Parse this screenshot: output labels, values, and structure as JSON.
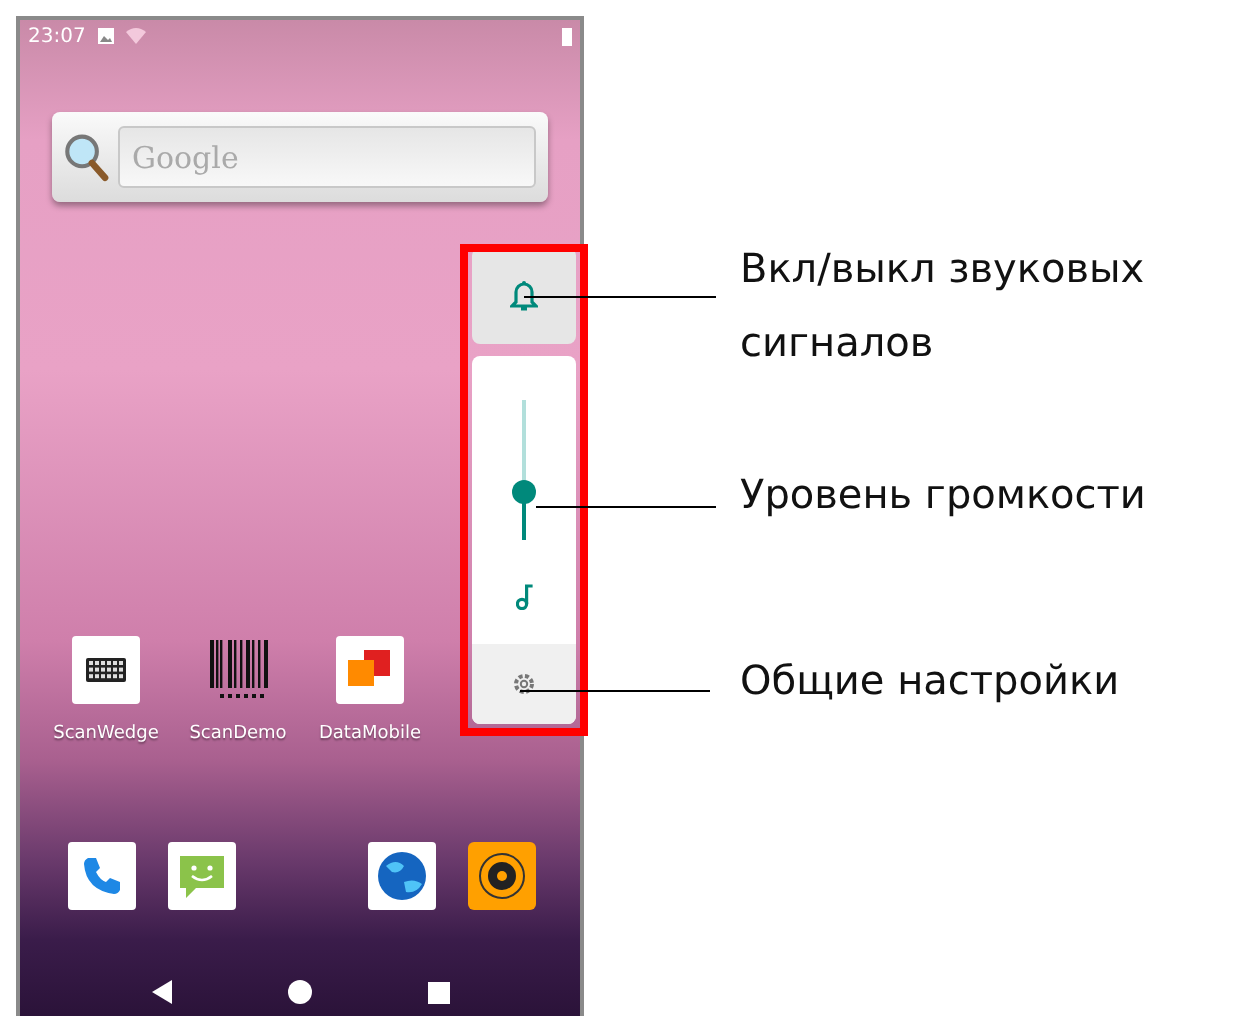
{
  "status_bar": {
    "time": "23:07"
  },
  "search_widget": {
    "placeholder": "Google"
  },
  "apps": [
    {
      "label": "ScanWedge",
      "kind": "keyboard"
    },
    {
      "label": "ScanDemo",
      "kind": "barcode"
    },
    {
      "label": "DataMobile",
      "kind": "squares"
    }
  ],
  "dock": [
    {
      "kind": "phone"
    },
    {
      "kind": "messages"
    },
    {
      "kind": "globe"
    },
    {
      "kind": "camera"
    }
  ],
  "volume_panel": {
    "level": 0.35
  },
  "annotations": [
    {
      "text": "Вкл/выкл звуковых сигналов"
    },
    {
      "text": "Уровень громкости"
    },
    {
      "text": "Общие настройки"
    }
  ]
}
